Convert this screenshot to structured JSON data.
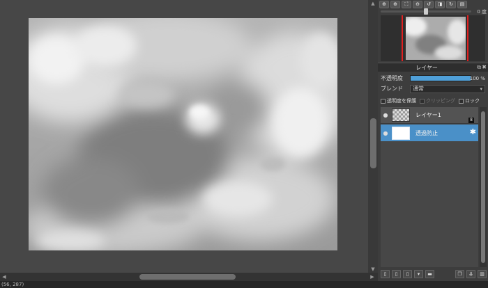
{
  "status": {
    "coords": "(56, 287)"
  },
  "navigator": {
    "toolbar": [
      {
        "name": "zoom-in-icon",
        "glyph": "⊕"
      },
      {
        "name": "zoom-magnify-icon",
        "glyph": "⊕"
      },
      {
        "name": "fit-window-icon",
        "glyph": "⛶"
      },
      {
        "name": "zoom-out-icon",
        "glyph": "⊖"
      },
      {
        "name": "rotate-left-icon",
        "glyph": "↺"
      },
      {
        "name": "flip-icon",
        "glyph": "◨"
      },
      {
        "name": "rotate-right-icon",
        "glyph": "↻"
      },
      {
        "name": "navigator-menu-icon",
        "glyph": "▤"
      }
    ],
    "rotation": "0 度"
  },
  "layers": {
    "title": "レイヤー",
    "opacity_label": "不透明度",
    "opacity_value": "100 %",
    "opacity_level": 1.0,
    "blend_label": "ブレンド",
    "blend_value": "通常",
    "options": {
      "protect_alpha": "透明度を保護",
      "clipping": "クリッピング",
      "lock": "ロック"
    },
    "items": [
      {
        "name": "レイヤー1",
        "badge": "8",
        "selected": false
      },
      {
        "name": "透過防止",
        "selected": true
      }
    ]
  },
  "colors": {
    "accent": "#4a90c8",
    "opacity_fill": "#4f9fd8",
    "nav_frame": "#e02020"
  },
  "layer_toolbar": [
    "new-layer-icon",
    "new-layer-special-icon",
    "new-raster-icon",
    "add-layer-dropdown-icon",
    "folder-icon",
    "duplicate-layer-icon",
    "merge-layer-icon",
    "delete-layer-icon"
  ]
}
